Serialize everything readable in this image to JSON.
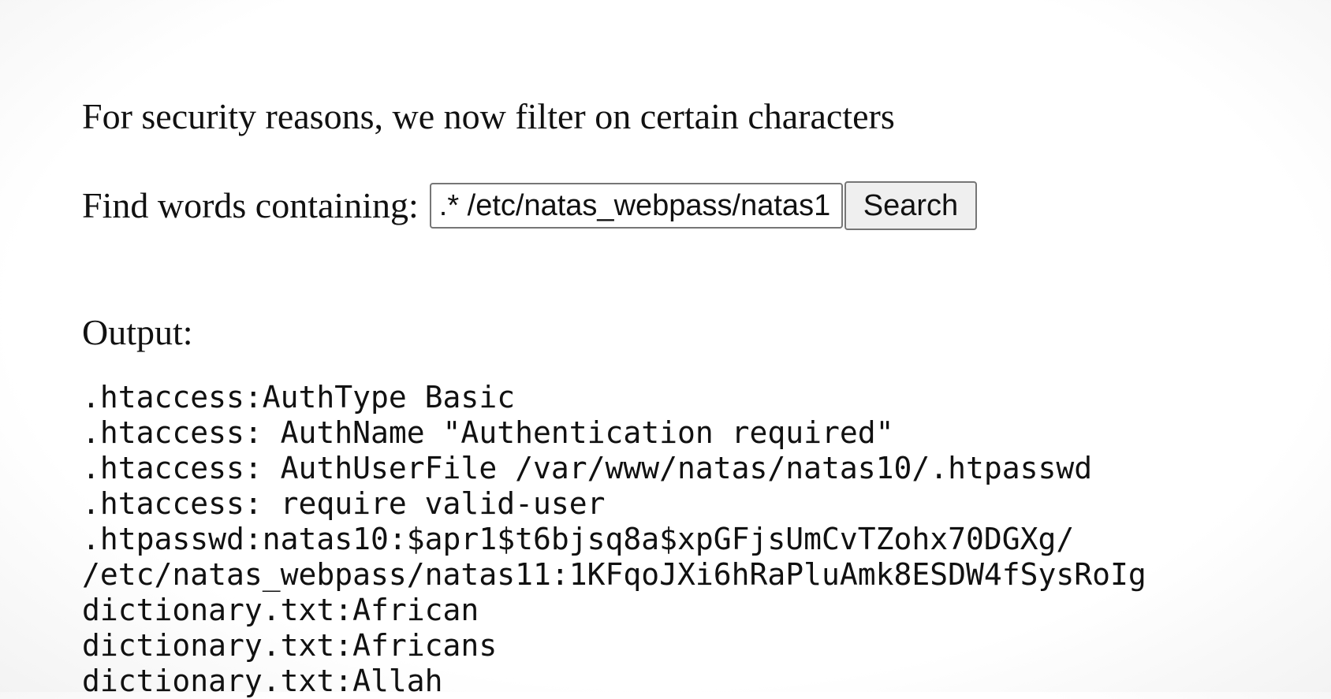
{
  "intro_text": "For security reasons, we now filter on certain characters",
  "form": {
    "label": "Find words containing:",
    "input_value": ".* /etc/natas_webpass/natas1",
    "button_label": "Search"
  },
  "output": {
    "label": "Output:",
    "lines": [
      ".htaccess:AuthType Basic",
      ".htaccess: AuthName \"Authentication required\"",
      ".htaccess: AuthUserFile /var/www/natas/natas10/.htpasswd",
      ".htaccess: require valid-user",
      ".htpasswd:natas10:$apr1$t6bjsq8a$xpGFjsUmCvTZohx70DGXg/",
      "/etc/natas_webpass/natas11:1KFqoJXi6hRaPluAmk8ESDW4fSysRoIg",
      "dictionary.txt:African",
      "dictionary.txt:Africans",
      "dictionary.txt:Allah"
    ]
  }
}
